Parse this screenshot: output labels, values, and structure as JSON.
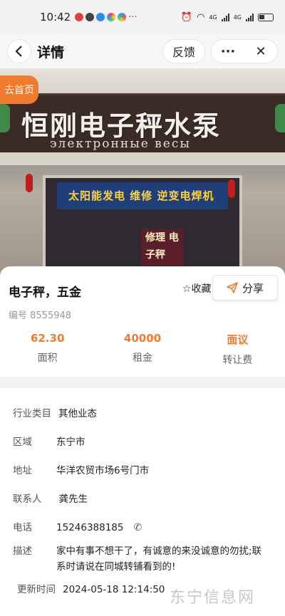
{
  "status": {
    "time": "10:42",
    "dots": "···",
    "signal1": "4G",
    "signal2": "4G"
  },
  "nav": {
    "title": "详情",
    "feedback": "反馈",
    "more": "···",
    "close": "✕"
  },
  "hero": {
    "home_tab": "去首页",
    "sign_main": "恒刚电子秤水泵",
    "sign_sub": "электронные весы",
    "banner1": "太阳能发电 维修 逆变电焊机",
    "banner2": "修理 电子秤"
  },
  "card": {
    "title": "电子秤，五金",
    "favorite": "☆收藏",
    "share": "分享",
    "id": "编号 8555948",
    "stats": [
      {
        "value": "62.30",
        "label": "面积"
      },
      {
        "value": "40000",
        "label": "租金"
      },
      {
        "value": "面议",
        "label": "转让费"
      }
    ]
  },
  "details": {
    "industry": {
      "label": "行业类目",
      "value": "其他业态"
    },
    "area": {
      "label": "区域",
      "value": "东宁市"
    },
    "address": {
      "label": "地址",
      "value": "华洋农贸市场6号门市"
    },
    "contact": {
      "label": "联系人",
      "value": "龚先生"
    },
    "phone": {
      "label": "电话",
      "value": "15246388185"
    },
    "desc": {
      "label": "描述",
      "line1": "家中有事不想干了，有诚意的来没诚意的勿扰;联",
      "line2": "系时请说在同城转铺看到的!"
    },
    "updated": {
      "label": "更新时间",
      "value": "2024-05-18 12:14:50"
    }
  },
  "watermark": "东宁信息网",
  "colors": {
    "accent": "#f07a2e",
    "background": "#f2f2f2"
  }
}
